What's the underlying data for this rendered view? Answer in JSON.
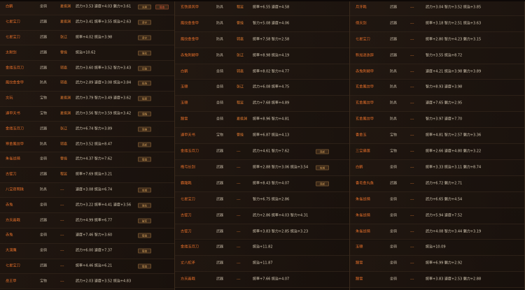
{
  "columns": [
    {
      "rows": [
        {
          "name": "白鹤",
          "type": "坐骑",
          "location": "夏侯渊",
          "stats": "武力+3.53 速度+4.03 魅力+3.61",
          "tags": [
            "兑换",
            "锻造"
          ]
        },
        {
          "name": "七星宝刀",
          "type": "武器",
          "location": "夏侯渊",
          "stats": "武力+3.41 统率+3.55 统治+2.63",
          "tags": [
            "坚守"
          ]
        },
        {
          "name": "七星宝刀",
          "type": "武器",
          "location": "张辽",
          "stats": "统率+4.02 统治+3.98",
          "tags": [
            "坚守"
          ]
        },
        {
          "name": "太尉剑",
          "type": "武器",
          "location": "曹操",
          "stats": "统治+10.62",
          "tags": [
            "强化"
          ]
        },
        {
          "name": "金缕玉月刀",
          "type": "武器",
          "location": "郭嘉",
          "stats": "武力+3.60 统率+3.52 智力+3.43",
          "tags": [
            "识破"
          ]
        },
        {
          "name": "鳳纹金金甲",
          "type": "防具",
          "location": "郭嘉",
          "stats": "武力+2.89 速度+3.08 统治+3.84",
          "tags": [
            "抵挡"
          ]
        },
        {
          "name": "文玩",
          "type": "宝物",
          "location": "夏侯渊",
          "stats": "武力+3.79 智力+3.49 速度+3.62",
          "tags": [
            "砥砺"
          ]
        },
        {
          "name": "通甲天书",
          "type": "宝物",
          "location": "夏侯渊",
          "stats": "武力+3.56 智力+3.59 统治+3.42",
          "tags": [
            "谋略"
          ]
        },
        {
          "name": "金缕玉月刀",
          "type": "武器",
          "location": "张辽",
          "stats": "武力+6.74 智力+3.89",
          "tags": [
            "突袭"
          ]
        },
        {
          "name": "寒金鳳纹甲",
          "type": "防具",
          "location": "郭嘉",
          "stats": "武力+3.52 统治+8.47",
          "tags": [
            "连斩"
          ]
        },
        {
          "name": "朱雀战骑",
          "type": "坐骑",
          "location": "曹操",
          "stats": "武力+4.37 智力+7.62",
          "tags": [
            "锻造"
          ]
        },
        {
          "name": "古锭刀",
          "type": "武器",
          "location": "程昱",
          "stats": "统率+7.69 统治+3.21",
          "tags": []
        },
        {
          "name": "八宝夜明珠",
          "type": "防具",
          "location": "---",
          "stats": "速度+3.08 统治+6.74",
          "tags": [
            "攻城"
          ]
        },
        {
          "name": "赤兔",
          "type": "坐骑",
          "location": "---",
          "stats": "武力+3.22 统率+4.41 速度+3.56",
          "tags": [
            "强化"
          ]
        },
        {
          "name": "方天画戟",
          "type": "武器",
          "location": "---",
          "stats": "武力+4.99 统率+6.77",
          "tags": [
            "破军"
          ]
        },
        {
          "name": "赤兔",
          "type": "坐骑",
          "location": "---",
          "stats": "速度+7.46 智力+3.60",
          "tags": [
            "锻造"
          ]
        },
        {
          "name": "大漠鹰",
          "type": "坐骑",
          "location": "---",
          "stats": "武力+6.00 速度+7.37",
          "tags": [
            "锻造"
          ]
        },
        {
          "name": "七星宝刀",
          "type": "武器",
          "location": "---",
          "stats": "统率+4.46 统治+6.21",
          "tags": [
            "锻造"
          ]
        },
        {
          "name": "岳王甲",
          "type": "宝物",
          "location": "---",
          "stats": "武力+2.03 速度+3.52 统治+4.83",
          "tags": []
        }
      ]
    },
    {
      "rows": [
        {
          "name": "玄铁追风甲",
          "type": "防具",
          "location": "程昱",
          "stats": "统率+6.55 速度+4.58",
          "tags": []
        },
        {
          "name": "鳳纹金金甲",
          "type": "防具",
          "location": "曹操",
          "stats": "智力+5.08 速度+4.06",
          "tags": []
        },
        {
          "name": "鳳纹金金甲",
          "type": "防具",
          "location": "郭嘉",
          "stats": "统率+7.58 智力+2.58",
          "tags": []
        },
        {
          "name": "赤兔刺鳞甲",
          "type": "防具",
          "location": "张辽",
          "stats": "统率+8.98 统治+4.19",
          "tags": []
        },
        {
          "name": "白鹤",
          "type": "坐骑",
          "location": "郭嘉",
          "stats": "统率+8.02 智力+4.77",
          "tags": []
        },
        {
          "name": "玉骢",
          "type": "坐骑",
          "location": "张辽",
          "stats": "武力+6.08 统率+4.75",
          "tags": []
        },
        {
          "name": "玉骢",
          "type": "坐骑",
          "location": "程昱",
          "stats": "武力+7.68 统率+4.89",
          "tags": []
        },
        {
          "name": "踏雪",
          "type": "坐骑",
          "location": "夏侯渊",
          "stats": "统率+8.96 智力+4.81",
          "tags": []
        },
        {
          "name": "通甲天书",
          "type": "宝物",
          "location": "曹操",
          "stats": "统率+6.87 统治+4.13",
          "tags": []
        },
        {
          "name": "金缕玉月刀",
          "type": "武器",
          "location": "---",
          "stats": "武力+4.61 智力+7.62",
          "tags": [
            "连斩"
          ]
        },
        {
          "name": "梅弓长剑",
          "type": "武器",
          "location": "---",
          "stats": "统率+2.88 智力+3.06 统治+3.54",
          "tags": [
            "攻城"
          ]
        },
        {
          "name": "霸龍戟",
          "type": "武器",
          "location": "---",
          "stats": "统率+8.43 智力+4.07",
          "tags": [
            "连斩"
          ]
        },
        {
          "name": "七星宝刀",
          "type": "武器",
          "location": "---",
          "stats": "智力+6.75 统治+2.86",
          "tags": []
        },
        {
          "name": "古锭刀",
          "type": "武器",
          "location": "---",
          "stats": "武力+2.86 统率+4.03 智力+4.31",
          "tags": []
        },
        {
          "name": "古锭刀",
          "type": "武器",
          "location": "---",
          "stats": "统率+3.83 智力+2.85 统治+3.23",
          "tags": []
        },
        {
          "name": "金缕玉月刀",
          "type": "武器",
          "location": "---",
          "stats": "统治+11.82",
          "tags": []
        },
        {
          "name": "丈八蛇矛",
          "type": "武器",
          "location": "---",
          "stats": "统治+11.87",
          "tags": []
        },
        {
          "name": "方天画戟",
          "type": "武器",
          "location": "---",
          "stats": "统率+7.66 统治+4.07",
          "tags": []
        }
      ]
    },
    {
      "rows": [
        {
          "name": "月牙戟",
          "type": "武器",
          "location": "---",
          "stats": "武力+3.04 智力+3.52 统治+3.85",
          "tags": []
        },
        {
          "name": "倚天剑",
          "type": "武器",
          "location": "---",
          "stats": "统率+3.18 智力+2.51 统治+3.63",
          "tags": []
        },
        {
          "name": "七星宝刀",
          "type": "武器",
          "location": "---",
          "stats": "统率+2.80 智力+4.23 魅力+3.15",
          "tags": []
        },
        {
          "name": "新加迷迭辞",
          "type": "武器",
          "location": "---",
          "stats": "智力+3.55 统治+8.72",
          "tags": []
        },
        {
          "name": "赤兔刺鳞甲",
          "type": "防具",
          "location": "---",
          "stats": "速度+4.21 统治+3.98 魅力+3.89",
          "tags": []
        },
        {
          "name": "玄金鳳纹甲",
          "type": "防具",
          "location": "---",
          "stats": "智力+8.93 速度+3.98",
          "tags": []
        },
        {
          "name": "玄金鳳纹甲",
          "type": "防具",
          "location": "---",
          "stats": "速度+7.65 魅力+2.95",
          "tags": []
        },
        {
          "name": "玄金鳳纹甲",
          "type": "防具",
          "location": "---",
          "stats": "智力+3.97 速度+7.70",
          "tags": []
        },
        {
          "name": "香金玉",
          "type": "宝物",
          "location": "---",
          "stats": "统率+4.81 智力+2.57 魅力+3.36",
          "tags": []
        },
        {
          "name": "三宝佛莲",
          "type": "宝物",
          "location": "---",
          "stats": "统率+2.66 速度+4.80 魅力+3.22",
          "tags": []
        },
        {
          "name": "白鹤",
          "type": "坐骑",
          "location": "---",
          "stats": "统率+3.33 统治+3.11 魅力+8.74",
          "tags": []
        },
        {
          "name": "香毛金丸鱼",
          "type": "武器",
          "location": "---",
          "stats": "武力+6.72 魅力+2.71",
          "tags": []
        },
        {
          "name": "朱雀战骑",
          "type": "坐骑",
          "location": "---",
          "stats": "武力+6.65 魅力+4.54",
          "tags": []
        },
        {
          "name": "朱雀战骑",
          "type": "坐骑",
          "location": "---",
          "stats": "武力+5.94 速度+7.52",
          "tags": []
        },
        {
          "name": "朱雀战骑",
          "type": "坐骑",
          "location": "---",
          "stats": "武力+4.08 智力+3.44 魅力+3.19",
          "tags": []
        },
        {
          "name": "玉骢",
          "type": "坐骑",
          "location": "---",
          "stats": "统治+10.09",
          "tags": []
        },
        {
          "name": "踏雪",
          "type": "坐骑",
          "location": "---",
          "stats": "统率+6.99 魅力+2.92",
          "tags": []
        },
        {
          "name": "踏雪",
          "type": "坐骑",
          "location": "---",
          "stats": "统率+3.83 速度+2.53 魅力+2.88",
          "tags": []
        }
      ]
    }
  ]
}
